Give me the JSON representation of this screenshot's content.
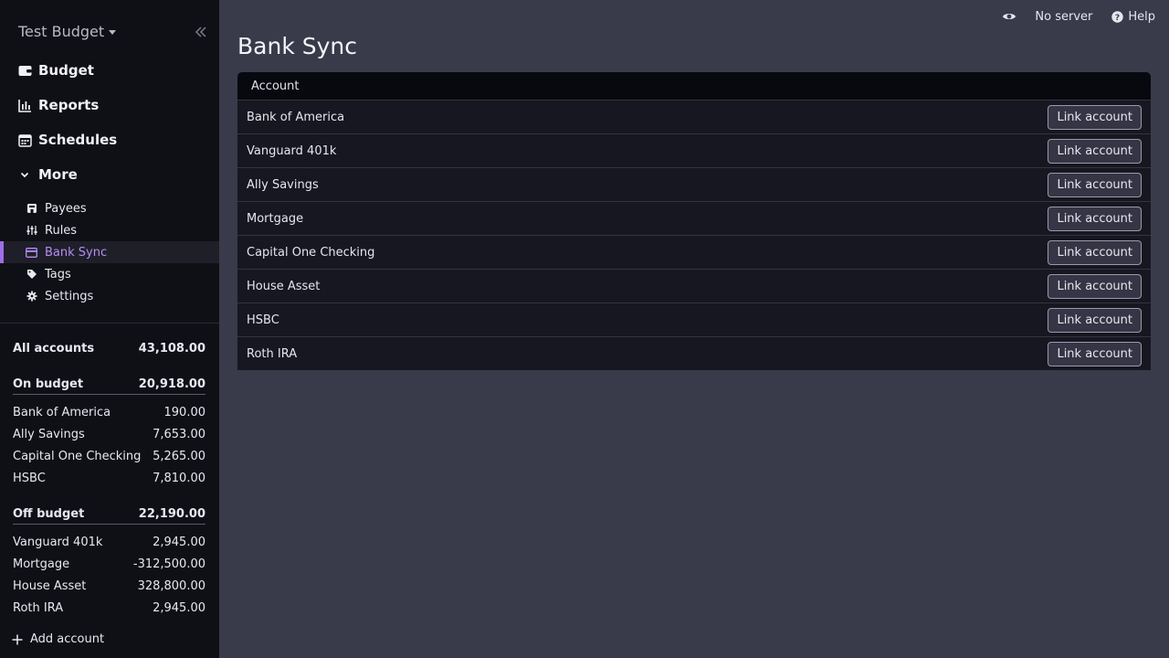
{
  "sidebar": {
    "budget_name": "Test Budget",
    "nav": [
      {
        "label": "Budget",
        "icon": "wallet-icon"
      },
      {
        "label": "Reports",
        "icon": "bar-chart-icon"
      },
      {
        "label": "Schedules",
        "icon": "calendar-icon"
      },
      {
        "label": "More",
        "icon": "chevron-down-icon"
      }
    ],
    "sub": [
      {
        "label": "Payees",
        "icon": "store-icon"
      },
      {
        "label": "Rules",
        "icon": "sliders-icon"
      },
      {
        "label": "Bank Sync",
        "icon": "credit-card-icon"
      },
      {
        "label": "Tags",
        "icon": "tag-icon"
      },
      {
        "label": "Settings",
        "icon": "gear-icon"
      }
    ],
    "accounts": {
      "all": {
        "label": "All accounts",
        "value": "43,108.00"
      },
      "on_budget": {
        "label": "On budget",
        "value": "20,918.00"
      },
      "on": [
        {
          "name": "Bank of America",
          "value": "190.00"
        },
        {
          "name": "Ally Savings",
          "value": "7,653.00"
        },
        {
          "name": "Capital One Checking",
          "value": "5,265.00"
        },
        {
          "name": "HSBC",
          "value": "7,810.00"
        }
      ],
      "off_budget": {
        "label": "Off budget",
        "value": "22,190.00"
      },
      "off": [
        {
          "name": "Vanguard 401k",
          "value": "2,945.00"
        },
        {
          "name": "Mortgage",
          "value": "-312,500.00"
        },
        {
          "name": "House Asset",
          "value": "328,800.00"
        },
        {
          "name": "Roth IRA",
          "value": "2,945.00"
        }
      ]
    },
    "add_account": "Add account"
  },
  "topbar": {
    "server": "No server",
    "help": "Help"
  },
  "page": {
    "title": "Bank Sync",
    "column_header": "Account",
    "button_label": "Link account",
    "rows": [
      "Bank of America",
      "Vanguard 401k",
      "Ally Savings",
      "Mortgage",
      "Capital One Checking",
      "House Asset",
      "HSBC",
      "Roth IRA"
    ]
  },
  "colors": {
    "accent": "#a06ee8",
    "sidebar_bg": "#0f0f16",
    "page_bg": "#393b4a"
  }
}
